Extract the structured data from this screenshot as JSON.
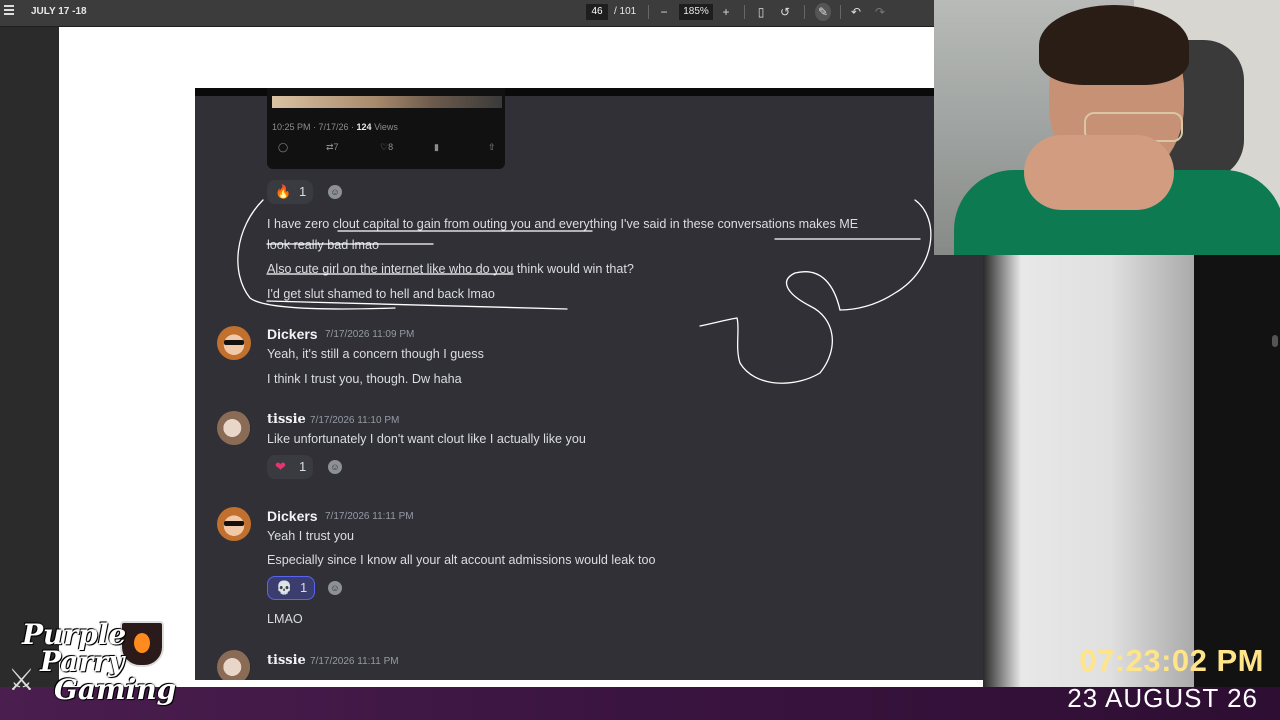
{
  "toolbar": {
    "doc_title": "JULY 17 -18",
    "page_current": "46",
    "page_total": "/ 101",
    "zoom": "185%",
    "icons": [
      "menu-icon",
      "zoom-out-icon",
      "zoom-in-icon",
      "fit-page-icon",
      "rotate-icon",
      "annotate-icon",
      "undo-icon",
      "redo-icon"
    ]
  },
  "tweet": {
    "time": "10:25 PM · 7/17/26 · ",
    "views_count": "124",
    "views_label": " Views",
    "retweets": "7",
    "likes": "8"
  },
  "reaction_fire": {
    "emoji": "🔥",
    "count": "1"
  },
  "messages_top": [
    "I have zero clout capital to gain from outing you and everything I've said in these conversations makes ME",
    "look really bad lmao",
    "Also cute girl on the internet like who do you think would win that?",
    "I'd get slut shamed to hell and back lmao"
  ],
  "msg1": {
    "user": "Dickers",
    "time": "7/17/2026 11:09 PM",
    "lines": [
      "Yeah, it's still a concern though I guess",
      "I think I trust you, though. Dw haha"
    ]
  },
  "msg2": {
    "user": "tissie",
    "time": "7/17/2026 11:10 PM",
    "lines": [
      "Like unfortunately I don't want clout like I actually like you"
    ],
    "reaction": {
      "emoji": "❤",
      "count": "1"
    }
  },
  "msg3": {
    "user": "Dickers",
    "time": "7/17/2026 11:11 PM",
    "lines": [
      "Yeah I trust you",
      "Especially since I know all your alt account admissions would leak too"
    ],
    "reaction": {
      "emoji": "💀",
      "count": "1"
    },
    "followup": "LMAO"
  },
  "msg4": {
    "user": "tissie",
    "time": "7/17/2026 11:11 PM"
  },
  "overlay": {
    "clock": "07:23:02 PM",
    "date": "23 AUGUST 26",
    "logo_line1": "Purple",
    "logo_line2": "Parry",
    "logo_line3": "Gaming"
  },
  "colors": {
    "discord_bg": "#303036",
    "clock": "#ffe48a",
    "bottom_bar": "#3a1440",
    "reaction_active": "#5865f2"
  }
}
